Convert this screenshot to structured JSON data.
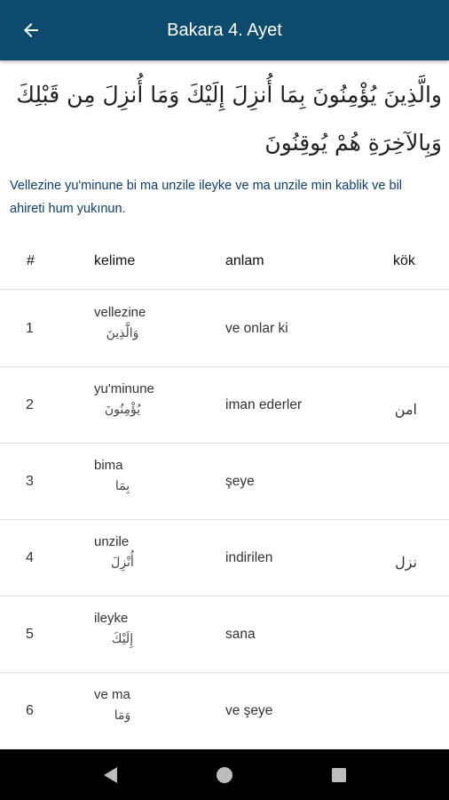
{
  "header": {
    "title": "Bakara 4. Ayet",
    "back_icon": "arrow-left-icon",
    "background": "#0c4a6e"
  },
  "verse": {
    "arabic": "والَّذِينَ يُؤْمِنُونَ بِمَا أُنزِلَ إِلَيْكَ وَمَا أُنزِلَ مِن قَبْلِكَ وَبِالآخِرَةِ هُمْ يُوقِنُونَ",
    "transliteration": "Vellezine yu'minune bi ma unzile ileyke ve ma unzile min kablik ve bil ahireti hum yukınun."
  },
  "table": {
    "headers": {
      "num": "#",
      "word": "kelime",
      "meaning": "anlam",
      "root": "kök"
    },
    "rows": [
      {
        "num": "1",
        "word": "vellezine",
        "word_ar": "وَالَّذِينَ",
        "meaning": "ve onlar ki",
        "root": ""
      },
      {
        "num": "2",
        "word": "yu'minune",
        "word_ar": "يُؤْمِنُونَ",
        "meaning": "iman ederler",
        "root": "امن"
      },
      {
        "num": "3",
        "word": "bima",
        "word_ar": "بِمَا",
        "meaning": "şeye",
        "root": ""
      },
      {
        "num": "4",
        "word": "unzile",
        "word_ar": "أُنْزِلَ",
        "meaning": "indirilen",
        "root": "نزل"
      },
      {
        "num": "5",
        "word": "ileyke",
        "word_ar": "إِلَيْكَ",
        "meaning": "sana",
        "root": ""
      },
      {
        "num": "6",
        "word": "ve ma",
        "word_ar": "وَمَا",
        "meaning": "ve şeye",
        "root": ""
      }
    ]
  },
  "nav": {
    "back_icon": "triangle-back-icon",
    "home_icon": "circle-home-icon",
    "recents_icon": "square-recents-icon"
  }
}
